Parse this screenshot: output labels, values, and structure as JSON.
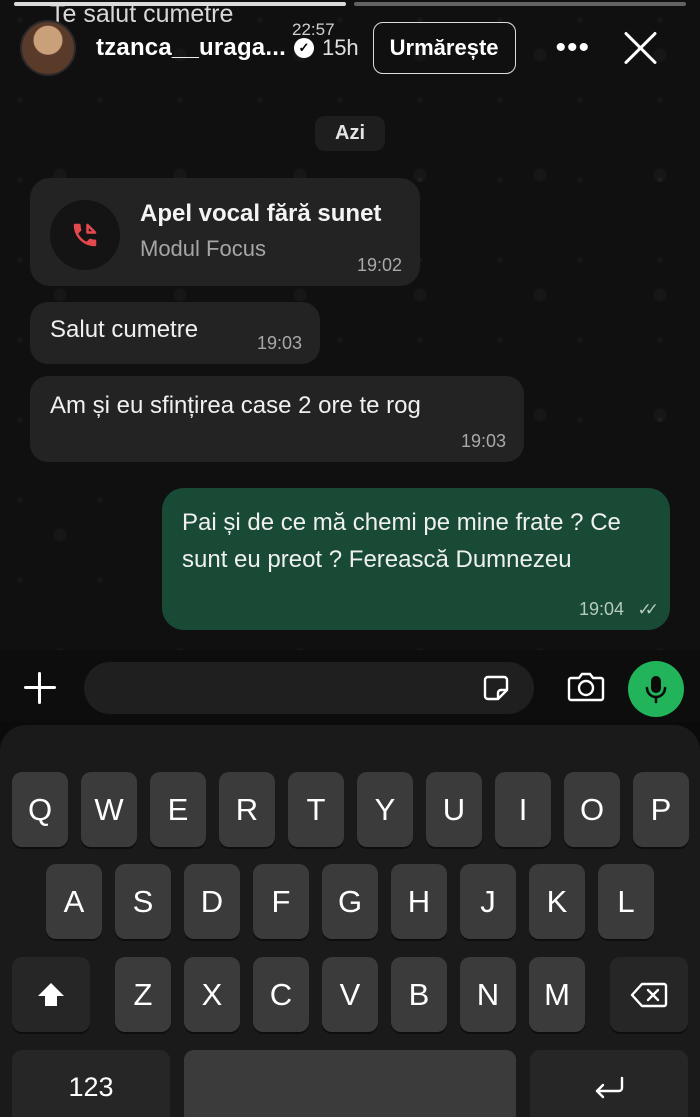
{
  "story": {
    "caption": "Te salut cumetre",
    "overlay_time": "22:57",
    "username": "tzanca__uraga...",
    "verified_mark": "✓",
    "age": "15h",
    "follow_label": "Urmărește",
    "more_icon": "more-icon",
    "close_icon": "close-icon"
  },
  "chat": {
    "date_label": "Azi",
    "call": {
      "title": "Apel vocal fără sunet",
      "subtitle": "Modul Focus",
      "time": "19:02",
      "icon": "missed-call-icon",
      "icon_color": "#e5484d"
    },
    "messages": [
      {
        "direction": "in",
        "text": "Salut cumetre",
        "time": "19:03"
      },
      {
        "direction": "in",
        "text": "Am și eu sfințirea case 2 ore te rog",
        "time": "19:03"
      },
      {
        "direction": "out",
        "text": "Pai și de ce mă chemi pe mine frate ? Ce sunt eu preot ? Ferească Dumnezeu",
        "time": "19:04",
        "status": "read"
      }
    ]
  },
  "composer": {
    "placeholder": "",
    "accent_color": "#22b45a"
  },
  "keyboard": {
    "row1": [
      "Q",
      "W",
      "E",
      "R",
      "T",
      "Y",
      "U",
      "I",
      "O",
      "P"
    ],
    "row2": [
      "A",
      "S",
      "D",
      "F",
      "G",
      "H",
      "J",
      "K",
      "L"
    ],
    "row3": [
      "Z",
      "X",
      "C",
      "V",
      "B",
      "N",
      "M"
    ],
    "numbers_label": "123",
    "space_label": ""
  }
}
